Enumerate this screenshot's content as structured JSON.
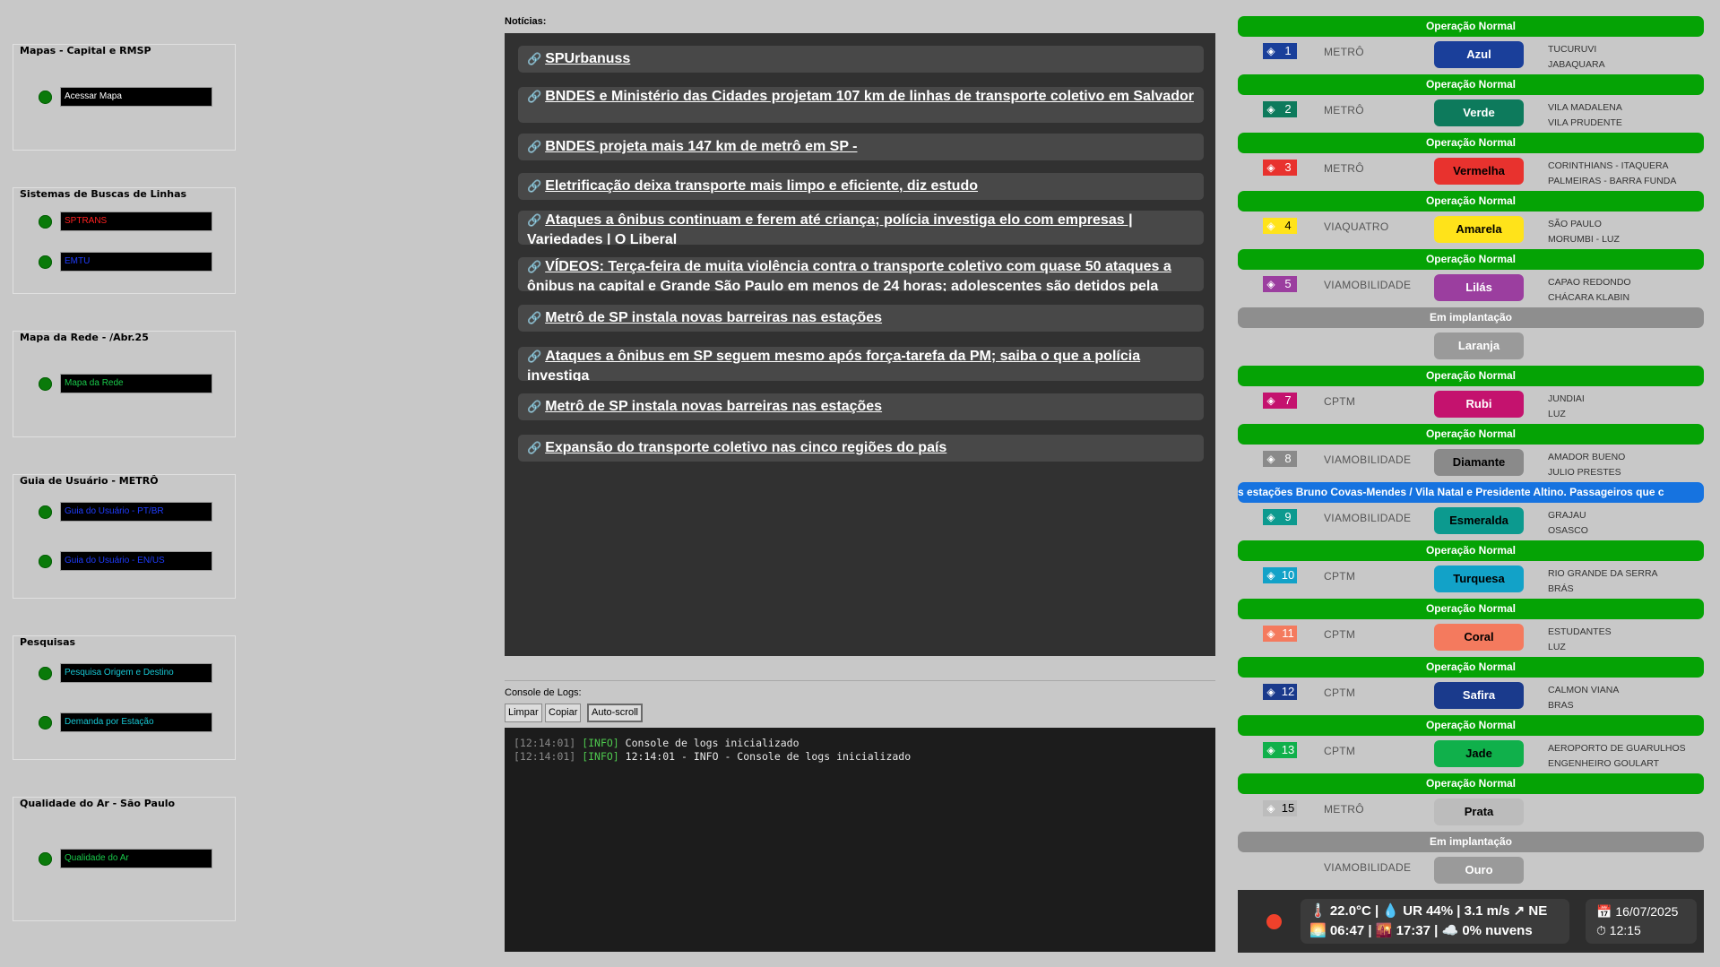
{
  "left": {
    "groups": [
      {
        "title": "Mapas - Capital e RMSP",
        "links": [
          {
            "label": "Acessar Mapa",
            "color": "#ffffff"
          }
        ]
      },
      {
        "title": "Sistemas de Buscas de Linhas",
        "links": [
          {
            "label": "SPTRANS",
            "color": "#ff2020"
          },
          {
            "label": "EMTU",
            "color": "#1f3cff"
          }
        ]
      },
      {
        "title": "Mapa da Rede - /Abr.25",
        "links": [
          {
            "label": "Mapa da Rede",
            "color": "#19c94a"
          }
        ]
      },
      {
        "title": "Guia de Usuário - METRÔ",
        "links": [
          {
            "label": "Guia do Usuário - PT/BR",
            "color": "#1f3cff"
          },
          {
            "label": "Guia do Usuário - EN/US",
            "color": "#1f3cff"
          }
        ]
      },
      {
        "title": "Pesquisas",
        "links": [
          {
            "label": "Pesquisa Origem e Destino",
            "color": "#17c7d4"
          },
          {
            "label": "Demanda por Estação",
            "color": "#17c7d4"
          }
        ]
      },
      {
        "title": "Qualidade do Ar - São Paulo",
        "links": [
          {
            "label": "Qualidade do Ar",
            "color": "#19c94a"
          }
        ]
      }
    ]
  },
  "news": {
    "label": "Notícias:",
    "items": [
      "SPUrbanuss",
      "BNDES e Ministério das Cidades projetam 107 km de linhas de transporte coletivo em Salvador",
      "BNDES projeta mais 147 km de metrô em SP -",
      "Eletrificação deixa transporte mais limpo e eficiente, diz estudo",
      "Ataques a ônibus continuam e ferem até criança; polícia investiga elo com empresas | Variedades | O Liberal",
      "VÍDEOS: Terça-feira de muita violência contra o transporte coletivo com quase 50 ataques a ônibus na capital e Grande São Paulo em menos de 24 horas; adolescentes são detidos pela GCM",
      "Metrô de SP instala novas barreiras nas estações",
      "Ataques a ônibus em SP seguem mesmo após força-tarefa da PM; saiba o que a polícia investiga",
      "Metrô de SP instala novas barreiras nas estações",
      "Expansão do transporte coletivo nas cinco regiões do país"
    ]
  },
  "console": {
    "label": "Console de Logs:",
    "buttons": {
      "clear": "Limpar",
      "copy": "Copiar",
      "autoscroll": "Auto-scroll"
    },
    "lines": [
      {
        "ts": "[12:14:01]",
        "level": "[INFO]",
        "msg": "Console de logs inicializado"
      },
      {
        "ts": "[12:14:01]",
        "level": "[INFO]",
        "msg": "12:14:01 - INFO - Console de logs inicializado"
      }
    ]
  },
  "lines": [
    {
      "status": "Operação Normal",
      "status_kind": "ok",
      "number": "1",
      "operator": "METRÔ",
      "name": "Azul",
      "color": "#1a3f9a",
      "text_color": "#ffffff",
      "sym_color": "#1a3f9a",
      "stations": [
        "TUCURUVI",
        "JABAQUARA"
      ]
    },
    {
      "status": "Operação Normal",
      "status_kind": "ok",
      "number": "2",
      "operator": "METRÔ",
      "name": "Verde",
      "color": "#0d7a5c",
      "text_color": "#ffffff",
      "sym_color": "#0d7a5c",
      "stations": [
        "VILA MADALENA",
        "VILA PRUDENTE"
      ]
    },
    {
      "status": "Operação Normal",
      "status_kind": "ok",
      "number": "3",
      "operator": "METRÔ",
      "name": "Vermelha",
      "color": "#e8322e",
      "text_color": "#000000",
      "sym_color": "#e8322e",
      "stations": [
        "CORINTHIANS - ITAQUERA",
        "PALMEIRAS - BARRA FUNDA"
      ]
    },
    {
      "status": "Operação Normal",
      "status_kind": "ok",
      "number": "4",
      "operator": "VIAQUATRO",
      "name": "Amarela",
      "color": "#ffe31a",
      "text_color": "#000000",
      "sym_color": "#ffe31a",
      "stations": [
        "SÃO PAULO",
        "MORUMBI - LUZ"
      ]
    },
    {
      "status": "Operação Normal",
      "status_kind": "ok",
      "number": "5",
      "operator": "VIAMOBILIDADE",
      "name": "Lilás",
      "color": "#9b3e9f",
      "text_color": "#ffffff",
      "sym_color": "#9b3e9f",
      "stations": [
        "CAPAO REDONDO",
        "CHÁCARA KLABIN"
      ]
    },
    {
      "status": "Em implantação",
      "status_kind": "imp",
      "number": "",
      "operator": "",
      "name": "Laranja",
      "color": "#9a9a9a",
      "text_color": "#ffffff",
      "sym_color": "",
      "stations": []
    },
    {
      "status": "Operação Normal",
      "status_kind": "ok",
      "number": "7",
      "operator": "CPTM",
      "name": "Rubi",
      "color": "#c4126e",
      "text_color": "#ffffff",
      "sym_color": "#c4126e",
      "stations": [
        "JUNDIAI",
        "LUZ"
      ]
    },
    {
      "status": "Operação Normal",
      "status_kind": "ok",
      "number": "8",
      "operator": "VIAMOBILIDADE",
      "name": "Diamante",
      "color": "#8a8a8a",
      "text_color": "#000000",
      "sym_color": "#8a8a8a",
      "stations": [
        "AMADOR BUENO",
        "JULIO PRESTES"
      ]
    },
    {
      "status": "s estações Bruno Covas-Mendes / Vila Natal e Presidente Altino. Passageiros que c",
      "status_kind": "msg",
      "number": "9",
      "operator": "VIAMOBILIDADE",
      "name": "Esmeralda",
      "color": "#0c9a8f",
      "text_color": "#000000",
      "sym_color": "#0c9a8f",
      "stations": [
        "GRAJAU",
        "OSASCO"
      ]
    },
    {
      "status": "Operação Normal",
      "status_kind": "ok",
      "number": "10",
      "operator": "CPTM",
      "name": "Turquesa",
      "color": "#12a2c8",
      "text_color": "#000000",
      "sym_color": "#12a2c8",
      "stations": [
        "RIO GRANDE DA SERRA",
        "BRÁS"
      ]
    },
    {
      "status": "Operação Normal",
      "status_kind": "ok",
      "number": "11",
      "operator": "CPTM",
      "name": "Coral",
      "color": "#f47a5e",
      "text_color": "#000000",
      "sym_color": "#f47a5e",
      "stations": [
        "ESTUDANTES",
        "LUZ"
      ]
    },
    {
      "status": "Operação Normal",
      "status_kind": "ok",
      "number": "12",
      "operator": "CPTM",
      "name": "Safira",
      "color": "#1a3a8c",
      "text_color": "#ffffff",
      "sym_color": "#1a3a8c",
      "stations": [
        "CALMON VIANA",
        "BRAS"
      ]
    },
    {
      "status": "Operação Normal",
      "status_kind": "ok",
      "number": "13",
      "operator": "CPTM",
      "name": "Jade",
      "color": "#10b04b",
      "text_color": "#000000",
      "sym_color": "#10b04b",
      "stations": [
        "AEROPORTO DE GUARULHOS",
        "ENGENHEIRO GOULART"
      ]
    },
    {
      "status": "Operação Normal",
      "status_kind": "ok",
      "number": "15",
      "operator": "METRÔ",
      "name": "Prata",
      "color": "#bcbcbc",
      "text_color": "#000000",
      "sym_color": "#bcbcbc",
      "stations": []
    },
    {
      "status": "Em implantação",
      "status_kind": "imp",
      "number": "",
      "operator": "VIAMOBILIDADE",
      "name": "Ouro",
      "color": "#9a9a9a",
      "text_color": "#ffffff",
      "sym_color": "",
      "stations": []
    }
  ],
  "footer": {
    "weather_line1": "🌡️ 22.0°C | 💧 UR 44% | 3.1 m/s ↗ NE",
    "weather_line2": "🌅 06:47 | 🌇 17:37 | ☁️ 0% nuvens",
    "date": "📅 16/07/2025",
    "time": "⏱ 12:15"
  }
}
